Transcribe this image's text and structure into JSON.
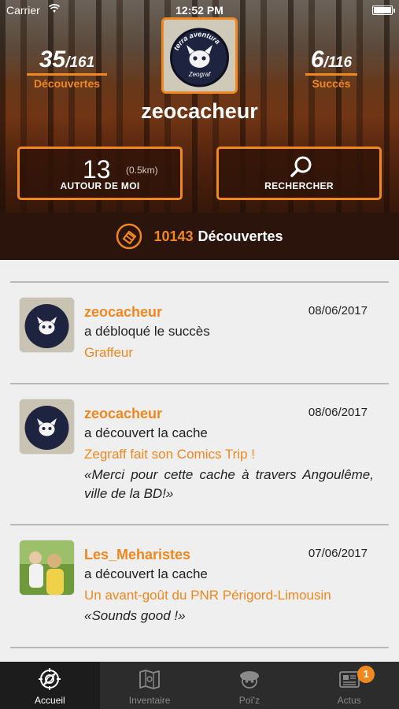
{
  "status_bar": {
    "carrier": "Carrier",
    "time": "12:52 PM"
  },
  "profile": {
    "username": "zeocacheur",
    "discoveries": {
      "count": "35",
      "total": "/161",
      "label": "Découvertes"
    },
    "achievements": {
      "count": "6",
      "total": "/116",
      "label": "Succès"
    },
    "avatar_logo_text": [
      "terra aventura",
      "Zeograf"
    ]
  },
  "actions": {
    "around_me": {
      "count": "13",
      "distance": "(0.5km)",
      "label": "AUTOUR DE MOI"
    },
    "search": {
      "label": "RECHERCHER",
      "icon": "magnifier-icon"
    }
  },
  "community": {
    "count": "10143",
    "label": "Découvertes",
    "icon": "cache-badge-icon"
  },
  "feed": [
    {
      "user": "zeocacheur",
      "date": "08/06/2017",
      "action": "a débloqué le succès",
      "target": "Graffeur",
      "quote": "",
      "avatar": "terra-aventura-logo"
    },
    {
      "user": "zeocacheur",
      "date": "08/06/2017",
      "action": "a découvert la cache",
      "target": "Zegraff fait son Comics Trip !",
      "quote": "«Merci pour cette cache à travers Angoulême, ville de la BD!»",
      "avatar": "terra-aventura-logo"
    },
    {
      "user": "Les_Meharistes",
      "date": "07/06/2017",
      "action": "a découvert la cache",
      "target": "Un avant-goût du PNR Périgord-Limousin",
      "quote": "«Sounds good !»",
      "avatar": "family-photo"
    }
  ],
  "tabs": [
    {
      "label": "Accueil",
      "icon": "compass-icon",
      "active": true
    },
    {
      "label": "Inventaire",
      "icon": "inventory-map-icon",
      "active": false
    },
    {
      "label": "Poï'z",
      "icon": "poiz-character-icon",
      "active": false
    },
    {
      "label": "Actus",
      "icon": "news-icon",
      "active": false,
      "badge": "1"
    }
  ],
  "colors": {
    "accent": "#f0871f",
    "bar_dark": "#2a140c",
    "tab_bg": "#2c2c2c",
    "feed_bg": "#efefef"
  }
}
